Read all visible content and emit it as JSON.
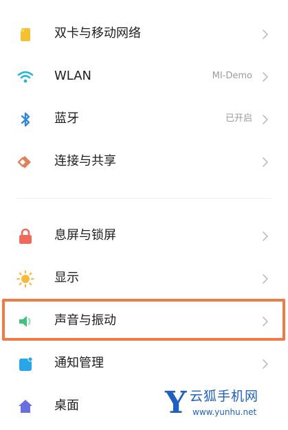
{
  "settings": {
    "group1": [
      {
        "label": "双卡与移动网络",
        "value": "",
        "icon": "sim-card-icon",
        "color": "#f5c12e"
      },
      {
        "label": "WLAN",
        "value": "MI-Demo",
        "icon": "wifi-icon",
        "color": "#27b7d6"
      },
      {
        "label": "蓝牙",
        "value": "已开启",
        "icon": "bluetooth-icon",
        "color": "#2f86d6"
      },
      {
        "label": "连接与共享",
        "value": "",
        "icon": "connection-share-icon",
        "color": "#e0805c"
      }
    ],
    "group2": [
      {
        "label": "息屏与锁屏",
        "value": "",
        "icon": "lock-icon",
        "color": "#ee6a5a"
      },
      {
        "label": "显示",
        "value": "",
        "icon": "sun-icon",
        "color": "#f6b93b"
      },
      {
        "label": "声音与振动",
        "value": "",
        "icon": "speaker-icon",
        "color": "#3cc57a"
      },
      {
        "label": "通知管理",
        "value": "",
        "icon": "notification-icon",
        "color": "#29a5e8"
      },
      {
        "label": "桌面",
        "value": "",
        "icon": "home-icon",
        "color": "#6a6fe0"
      }
    ]
  },
  "highlight": {
    "color": "#f07a45",
    "target": "声音与振动"
  },
  "watermark": {
    "letter": "Y",
    "text": "云狐手机网",
    "url": "www.yunhu.net"
  }
}
